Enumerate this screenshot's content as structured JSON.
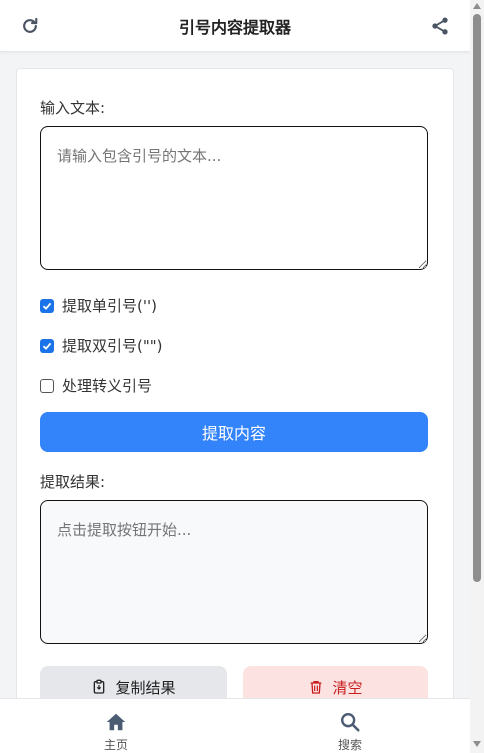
{
  "header": {
    "title": "引号内容提取器",
    "refresh_icon": "refresh-icon",
    "share_icon": "share-icon"
  },
  "input": {
    "label": "输入文本:",
    "placeholder": "请输入包含引号的文本..."
  },
  "options": [
    {
      "label": "提取单引号('')",
      "checked": true
    },
    {
      "label": "提取双引号(\"\")",
      "checked": true
    },
    {
      "label": "处理转义引号",
      "checked": false
    }
  ],
  "extract_button": {
    "label": "提取内容"
  },
  "output": {
    "label": "提取结果:",
    "placeholder": "点击提取按钮开始..."
  },
  "actions": {
    "copy_label": "复制结果",
    "clear_label": "清空"
  },
  "nav": {
    "home_label": "主页",
    "search_label": "搜索"
  },
  "colors": {
    "primary": "#3383fb",
    "danger_bg": "#fde2e2",
    "danger_text": "#c81e1e",
    "neutral_bg": "#e5e7eb"
  }
}
